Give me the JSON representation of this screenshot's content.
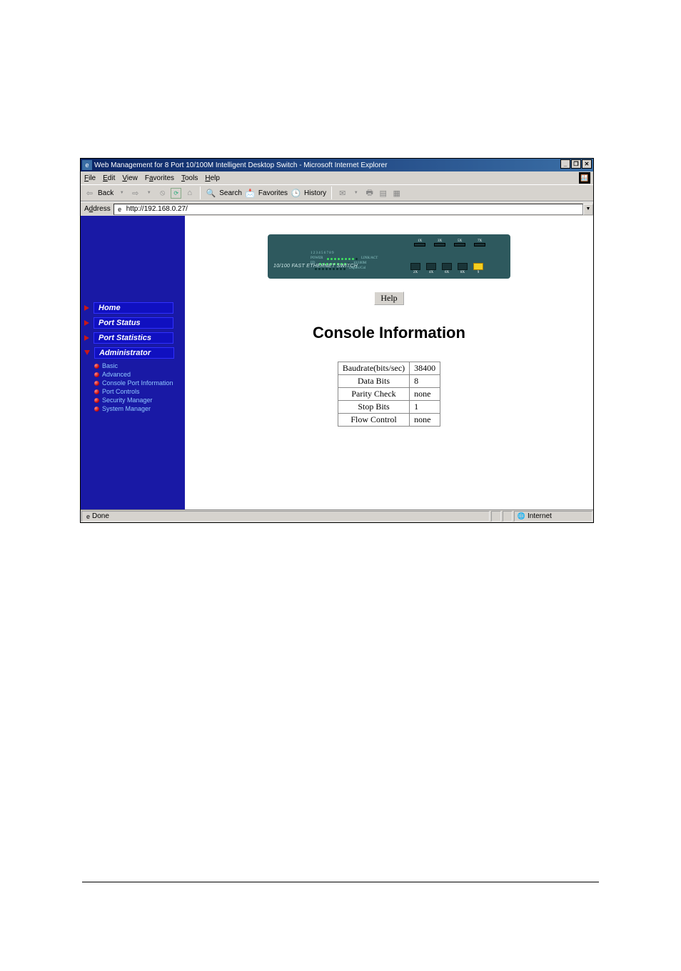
{
  "window": {
    "title": "Web Management for 8 Port 10/100M Intelligent Desktop Switch - Microsoft Internet Explorer",
    "min": "_",
    "max": "❐",
    "close": "✕"
  },
  "menu": {
    "file": {
      "u": "F",
      "rest": "ile"
    },
    "edit": {
      "u": "E",
      "rest": "dit"
    },
    "view": {
      "u": "V",
      "rest": "iew"
    },
    "fav": {
      "pre": "F",
      "u": "a",
      "rest": "vorites"
    },
    "tools": {
      "u": "T",
      "rest": "ools"
    },
    "help": {
      "u": "H",
      "rest": "elp"
    }
  },
  "toolbar": {
    "back": "Back",
    "search": "Search",
    "favorites": "Favorites",
    "history": "History"
  },
  "address": {
    "label_pre": "A",
    "label_u": "d",
    "label_rest": "dress",
    "url": "http://192.168.0.27/"
  },
  "sidebar": {
    "items": [
      {
        "label": "Home"
      },
      {
        "label": "Port Status"
      },
      {
        "label": "Port Statistics"
      },
      {
        "label": "Administrator"
      }
    ],
    "sub": [
      {
        "label": "Basic"
      },
      {
        "label": "Advanced"
      },
      {
        "label": "Console Port Information"
      },
      {
        "label": "Port Controls"
      },
      {
        "label": "Security Manager"
      },
      {
        "label": "System Manager"
      }
    ]
  },
  "switch": {
    "label": "10/100 FAST ETHERNET SWITCH",
    "top_labels": [
      "1X",
      "3X",
      "5X",
      "7X"
    ],
    "bottom_labels": [
      "2X",
      "4X",
      "6X",
      "8X",
      "9"
    ],
    "led_labels": {
      "power": "POWER",
      "fd": "FD",
      "ten": "10/100M",
      "dup": "Duplex/Col",
      "link": "LINK/ACT"
    }
  },
  "main": {
    "help": "Help",
    "heading": "Console Information",
    "rows": [
      {
        "label": "Baudrate(bits/sec)",
        "value": "38400"
      },
      {
        "label": "Data Bits",
        "value": "8"
      },
      {
        "label": "Parity Check",
        "value": "none"
      },
      {
        "label": "Stop Bits",
        "value": "1"
      },
      {
        "label": "Flow Control",
        "value": "none"
      }
    ]
  },
  "status": {
    "done": "Done",
    "zone": "Internet"
  }
}
